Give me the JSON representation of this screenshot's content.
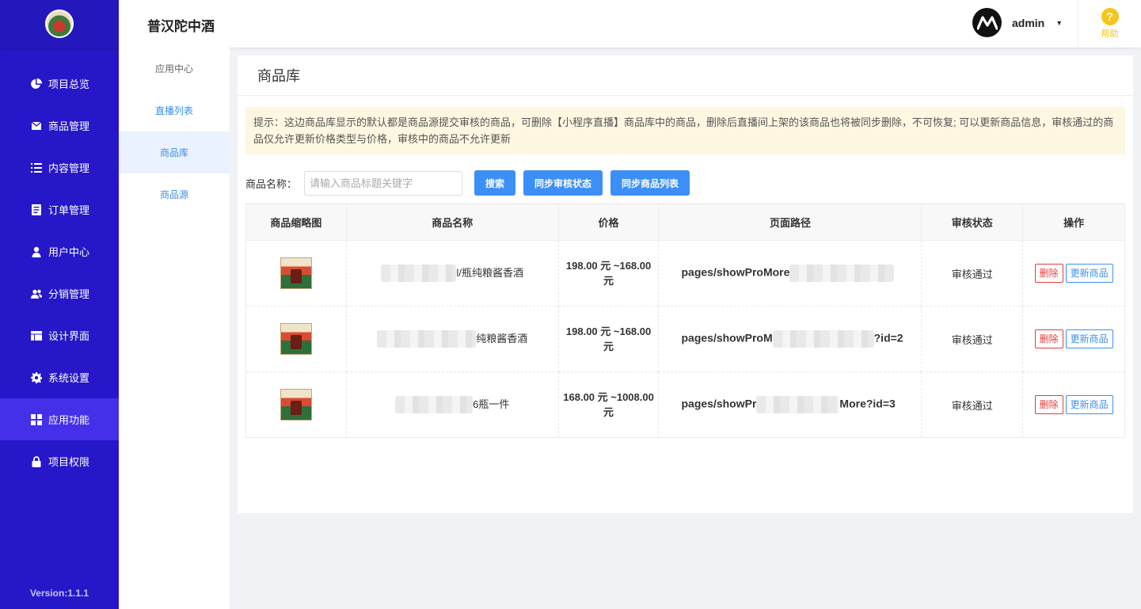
{
  "header": {
    "app_title": "普汉陀中酒",
    "username": "admin",
    "help_label": "帮助"
  },
  "sidebar": {
    "items": [
      {
        "label": "项目总览",
        "icon": "pie-chart-icon"
      },
      {
        "label": "商品管理",
        "icon": "envelope-icon"
      },
      {
        "label": "内容管理",
        "icon": "list-icon"
      },
      {
        "label": "订单管理",
        "icon": "document-icon"
      },
      {
        "label": "用户中心",
        "icon": "user-icon"
      },
      {
        "label": "分销管理",
        "icon": "users-icon"
      },
      {
        "label": "设计界面",
        "icon": "layout-icon"
      },
      {
        "label": "系统设置",
        "icon": "gear-icon"
      },
      {
        "label": "应用功能",
        "icon": "grid-icon",
        "active": true
      },
      {
        "label": "项目权限",
        "icon": "lock-icon"
      }
    ],
    "version": "Version:1.1.1"
  },
  "subnav": {
    "items": [
      {
        "label": "应用中心"
      },
      {
        "label": "直播列表"
      },
      {
        "label": "商品库",
        "active": true
      },
      {
        "label": "商品源"
      }
    ]
  },
  "main": {
    "page_title": "商品库",
    "tip": "提示：这边商品库显示的默认都是商品源提交审核的商品，可删除【小程序直播】商品库中的商品，删除后直播间上架的该商品也将被同步删除，不可恢复; 可以更新商品信息，审核通过的商品仅允许更新价格类型与价格，审核中的商品不允许更新",
    "search": {
      "label": "商品名称：",
      "placeholder": "请输入商品标题关键字",
      "value": "",
      "search_btn": "搜索",
      "sync_status_btn": "同步审核状态",
      "sync_list_btn": "同步商品列表"
    },
    "table": {
      "columns": [
        "商品缩略图",
        "商品名称",
        "价格",
        "页面路径",
        "审核状态",
        "操作"
      ],
      "rows": [
        {
          "name_visible": "l/瓶纯粮酱香酒",
          "price_line1": "198.00 元 ~168.00",
          "price_line2": "元",
          "path_prefix": "pages/showProMore",
          "path_suffix": "",
          "status": "审核通过",
          "delete": "删除",
          "update": "更新商品"
        },
        {
          "name_visible": "纯粮酱香酒",
          "price_line1": "198.00 元 ~168.00",
          "price_line2": "元",
          "path_prefix": "pages/showProM",
          "path_suffix": "?id=2",
          "status": "审核通过",
          "delete": "删除",
          "update": "更新商品"
        },
        {
          "name_visible": "6瓶一件",
          "price_line1": "168.00 元 ~1008.00",
          "price_line2": "元",
          "path_prefix": "pages/showPr",
          "path_suffix": "More?id=3",
          "status": "审核通过",
          "delete": "删除",
          "update": "更新商品"
        }
      ]
    }
  },
  "colors": {
    "sidebar_bg": "#2618c8",
    "sidebar_active": "#4430e8",
    "primary": "#3c8ff7",
    "success": "#22b02e",
    "danger": "#e53b3b",
    "help": "#f5c518"
  }
}
